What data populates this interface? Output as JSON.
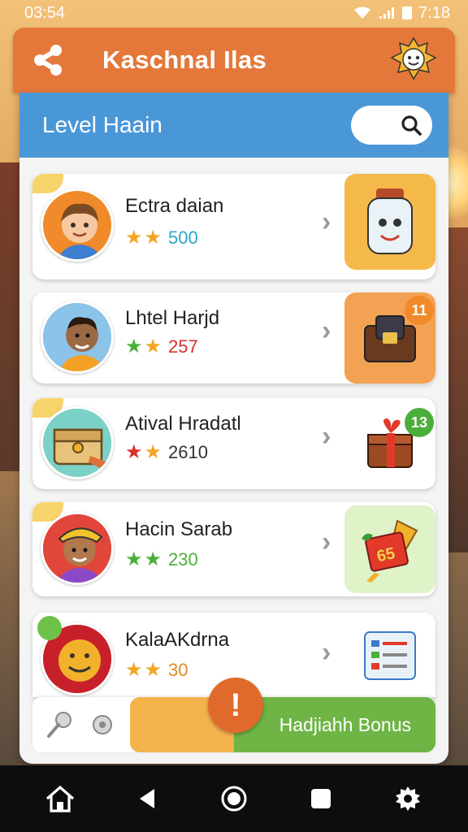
{
  "status_bar": {
    "time_left": "03:54",
    "time_right": "7:18"
  },
  "header": {
    "title": "Kaschnal Ilas",
    "accent_color": "#e4783a"
  },
  "level": {
    "title": "Level Haain",
    "search_icon": "search-icon"
  },
  "cards": [
    {
      "name": "Ectra daian",
      "score": "500",
      "score_color": "#2aa7c9",
      "reward_icon": "mascot-jar-icon"
    },
    {
      "name": "Lhtel Harjd",
      "score": "257",
      "score_color": "#d9302c",
      "reward_icon": "treasure-box-icon",
      "badge": "11"
    },
    {
      "name": "Atival Hradatl",
      "score": "2610",
      "score_color": "#333333",
      "reward_icon": "gift-chest-icon",
      "badge": "13"
    },
    {
      "name": "Hacin Sarab",
      "score": "230",
      "score_color": "#4cae3a",
      "reward_icon": "lucky-ticket-icon"
    },
    {
      "name": "KalaAKdrna",
      "score": "30",
      "score_color": "#e28a1e",
      "reward_icon": "checklist-icon"
    }
  ],
  "bottom": {
    "bonus_label": "Hadjiahh Bonus",
    "alert_symbol": "!"
  }
}
